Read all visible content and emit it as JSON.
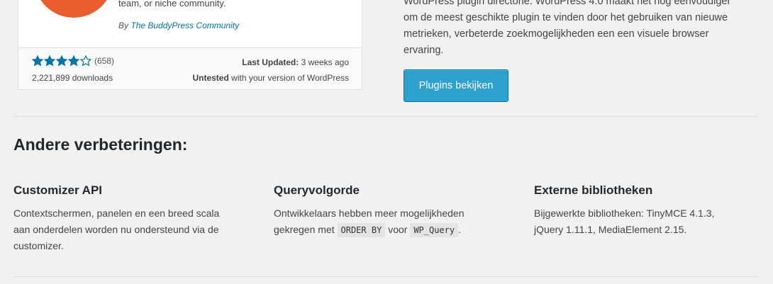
{
  "plugin_card": {
    "description_fragment": "team, or niche community.",
    "author_prefix": "By",
    "author_name": "The BuddyPress Community",
    "rating": 4,
    "rating_max": 5,
    "rating_count": "(658)",
    "downloads": "2,221,899 downloads",
    "last_updated_label": "Last Updated:",
    "last_updated_value": "3 weeks ago",
    "compat_bold": "Untested",
    "compat_rest": "with your version of WordPress",
    "icon_color": "#e95e2e"
  },
  "feature": {
    "text_lines": [
      "WordPress plugin directorie. WordPress 4.0 maakt het nog eenvoudiger",
      "om de meest geschikte plugin te vinden door het gebruiken van nieuwe",
      "metrieken, verbeterde zoekmogelijkheden een een visuele browser",
      "ervaring."
    ],
    "button_label": "Plugins bekijken",
    "button_color": "#2ea2cc"
  },
  "section": {
    "title": "Andere verbeteringen:",
    "columns": [
      {
        "title": "Customizer API",
        "lines": [
          "Contextschermen, panelen en een breed scala",
          "aan onderdelen worden nu ondersteund via de",
          "customizer."
        ]
      },
      {
        "title": "Queryvolgorde",
        "line1": "Ontwikkelaars hebben meer mogelijkheden",
        "line2_a": "gekregen met",
        "code1": "ORDER BY",
        "line2_b": "voor",
        "code2": "WP_Query",
        "line2_c": "."
      },
      {
        "title": "Externe bibliotheken",
        "lines": [
          "Bijgewerkte bibliotheken: TinyMCE 4.1.3,",
          "jQuery 1.11.1, MediaElement 2.15."
        ]
      }
    ]
  }
}
